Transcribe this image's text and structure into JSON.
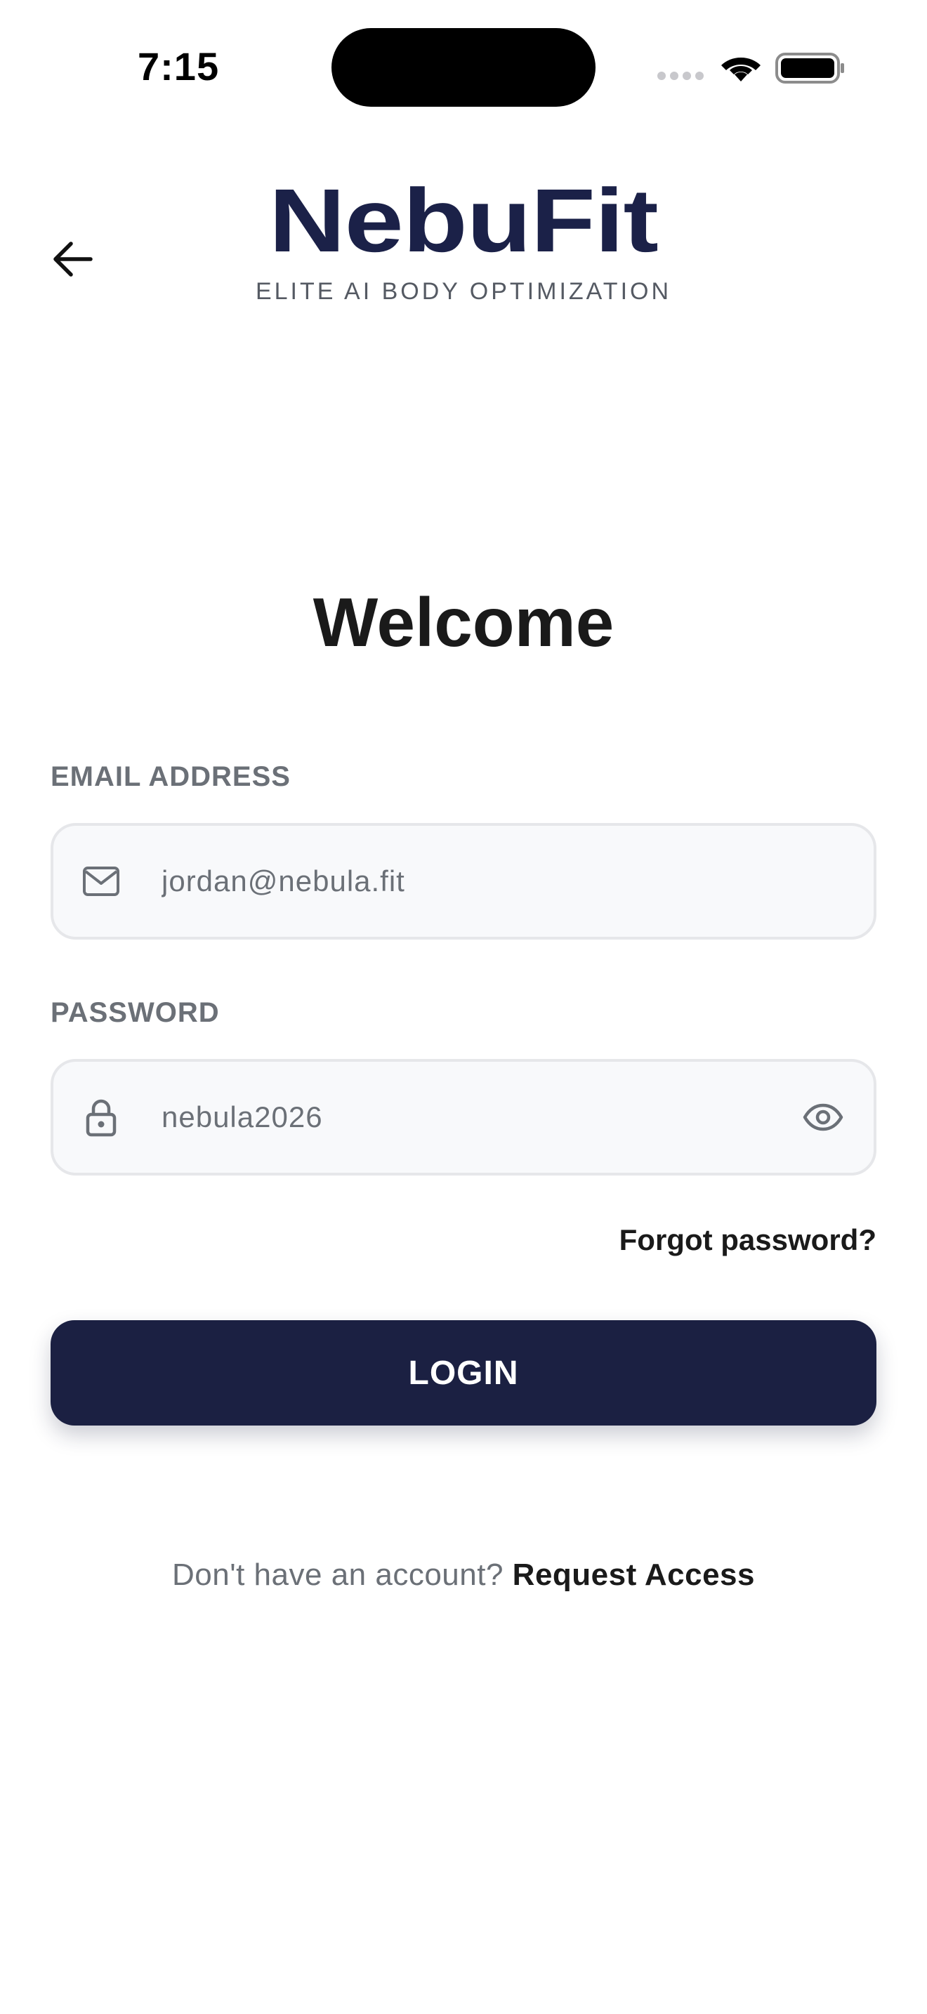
{
  "status_bar": {
    "time": "7:15"
  },
  "header": {
    "back_icon": "arrow-left-icon",
    "brand_name": "NebuFit",
    "tagline": "ELITE AI BODY OPTIMIZATION"
  },
  "main": {
    "title": "Welcome",
    "email": {
      "label": "EMAIL ADDRESS",
      "value": "jordan@nebula.fit",
      "icon": "mail-icon"
    },
    "password": {
      "label": "PASSWORD",
      "value": "nebula2026",
      "icon": "lock-icon",
      "toggle_icon": "eye-icon"
    },
    "forgot_label": "Forgot password?",
    "login_label": "LOGIN",
    "signup_prompt": "Don't have an account?",
    "signup_link": "Request Access"
  },
  "colors": {
    "brand": "#1b2148",
    "button": "#1b2042",
    "label": "#6b7077",
    "field_bg": "#f8f9fb",
    "field_border": "#e6e7ea"
  }
}
